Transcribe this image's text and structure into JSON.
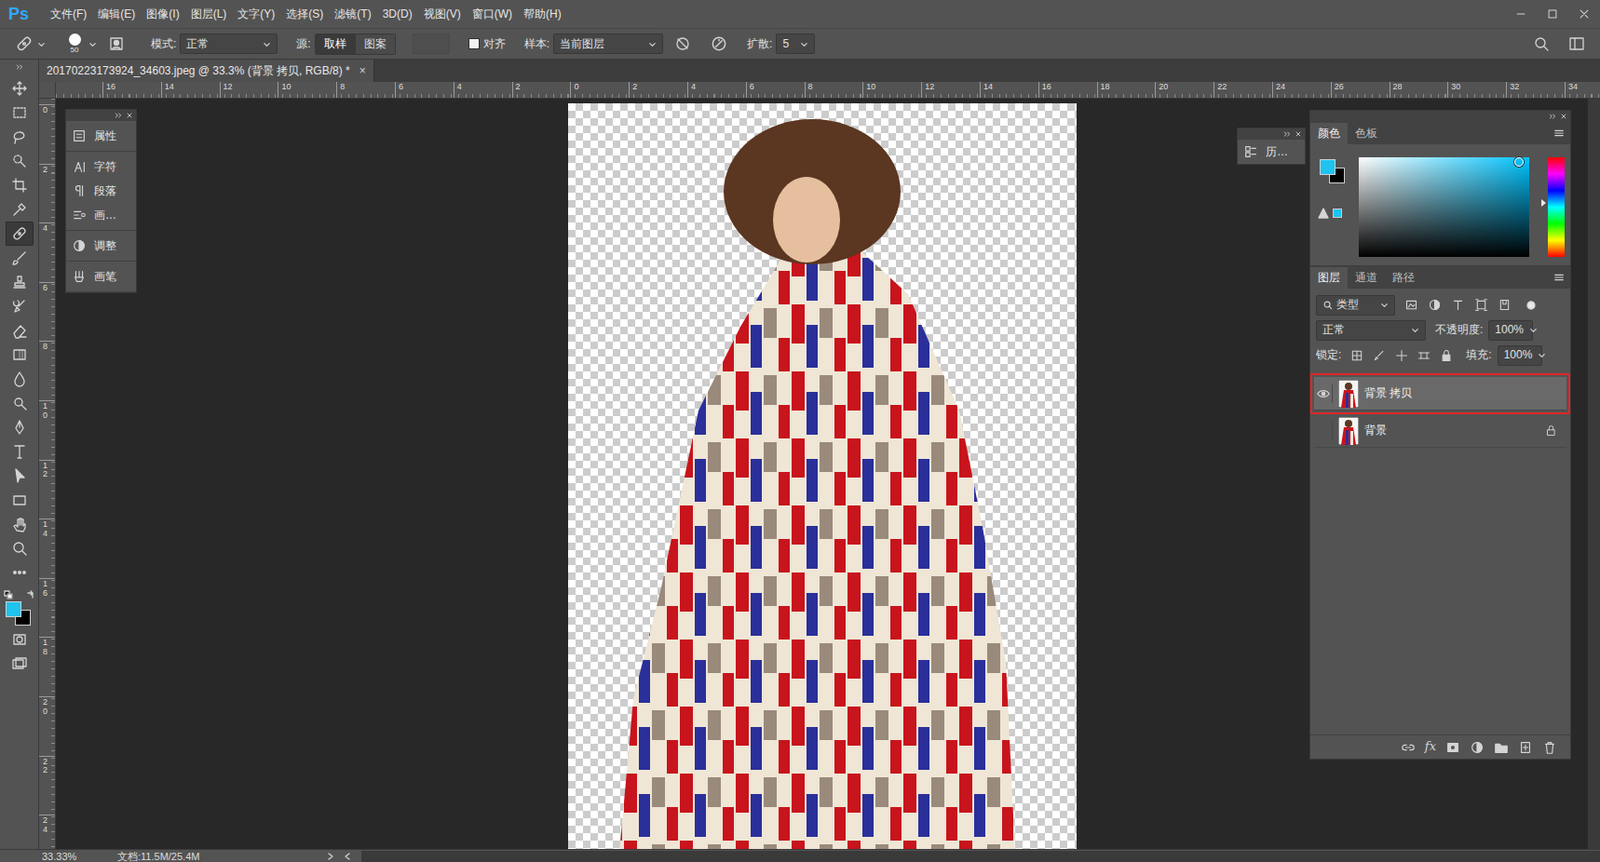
{
  "app": {
    "logo": "Ps"
  },
  "menu": [
    "文件(F)",
    "编辑(E)",
    "图像(I)",
    "图层(L)",
    "文字(Y)",
    "选择(S)",
    "滤镜(T)",
    "3D(D)",
    "视图(V)",
    "窗口(W)",
    "帮助(H)"
  ],
  "options": {
    "brush_size": "50",
    "mode_label": "模式:",
    "mode": "正常",
    "source_label": "源:",
    "source_buttons": [
      {
        "label": "取样",
        "selected": true
      },
      {
        "label": "图案",
        "selected": false
      }
    ],
    "aligned": {
      "label": "对齐",
      "checked": false
    },
    "sample_label": "样本:",
    "sample": "当前图层",
    "diffusion_label": "扩散:",
    "diffusion": "5"
  },
  "document_tab": {
    "title": "20170223173924_34603.jpeg @ 33.3% (背景 拷贝, RGB/8) *",
    "close": "×"
  },
  "rulers": {
    "horizontal": [
      "16",
      "14",
      "12",
      "10",
      "8",
      "6",
      "4",
      "2",
      "0",
      "2",
      "4",
      "6",
      "8",
      "10",
      "12",
      "14",
      "16",
      "18",
      "20",
      "22",
      "24",
      "26",
      "28",
      "30",
      "32",
      "34"
    ],
    "vertical": [
      "0",
      "2",
      "4",
      "6",
      "8",
      "10",
      "12",
      "14",
      "16",
      "18",
      "20",
      "22",
      "24"
    ]
  },
  "tools": [
    {
      "selected": false
    },
    {
      "selected": false
    },
    {
      "selected": false
    },
    {
      "selected": false
    },
    {
      "selected": false
    },
    {
      "selected": false
    },
    {
      "selected": true
    },
    {
      "selected": false
    },
    {
      "selected": false
    },
    {
      "selected": false
    },
    {
      "selected": false
    },
    {
      "selected": false
    },
    {
      "selected": false
    },
    {
      "selected": false
    },
    {
      "selected": false
    },
    {
      "selected": false
    },
    {
      "selected": false
    },
    {
      "selected": false
    },
    {
      "selected": false
    },
    {
      "selected": false
    },
    {
      "selected": false
    }
  ],
  "colors": {
    "foreground": "#1ec3ef",
    "background": "#000000"
  },
  "side_panel": {
    "groups": [
      [
        "属性"
      ],
      [
        "字符",
        "段落",
        "画…"
      ],
      [
        "调整"
      ],
      [
        "画笔"
      ]
    ]
  },
  "history_panel": {
    "label": "历…"
  },
  "color_panel": {
    "tabs": [
      {
        "label": "颜色",
        "selected": true
      },
      {
        "label": "色板",
        "selected": false
      }
    ],
    "hue_level": 0.46,
    "saturation": 0.94,
    "brightness": 0.95
  },
  "layers_panel": {
    "tabs": [
      {
        "label": "图层",
        "selected": true
      },
      {
        "label": "通道",
        "selected": false
      },
      {
        "label": "路径",
        "selected": false
      }
    ],
    "filter": "类型",
    "blend_mode": "正常",
    "opacity_label": "不透明度:",
    "opacity": "100%",
    "lock_label": "锁定:",
    "fill_label": "填充:",
    "fill": "100%",
    "fx_label": "fx",
    "layers": [
      {
        "name": "背景 拷贝",
        "visible": true,
        "selected": true,
        "locked": false
      },
      {
        "name": "背景",
        "visible": false,
        "selected": false,
        "locked": true
      }
    ]
  },
  "status_bar": {
    "zoom": "33.33%",
    "doc": "文档:11.5M/25.4M"
  }
}
